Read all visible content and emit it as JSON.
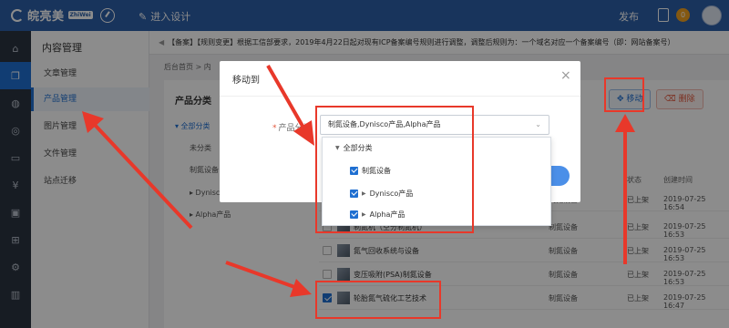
{
  "topbar": {
    "logo_text": "皖亮美",
    "logo_sub": "ZhiWei",
    "design_link": "进入设计",
    "publish": "发布",
    "badge_count": "0"
  },
  "rail_icons": [
    "home-icon",
    "copy-icon",
    "globe-icon",
    "compass-icon",
    "chat-icon",
    "dollar-icon",
    "bag-icon",
    "gift-icon",
    "settings-icon",
    "trash-icon"
  ],
  "sidebar": {
    "title": "内容管理",
    "items": [
      {
        "label": "文章管理"
      },
      {
        "label": "产品管理"
      },
      {
        "label": "图片管理"
      },
      {
        "label": "文件管理"
      },
      {
        "label": "站点迁移"
      }
    ]
  },
  "notice": {
    "text": "【备案】【规则变更】根据工信部要求，2019年4月22日起对现有ICP备案编号规则进行调整，调整后规则为：一个域名对应一个备案编号（即：网站备案号）"
  },
  "breadcrumb": {
    "home": "后台首页",
    "sep": ">",
    "current": "内"
  },
  "main": {
    "category_title": "产品分类",
    "categories": [
      {
        "label": "▾ 全部分类"
      },
      {
        "label": "未分类"
      },
      {
        "label": "制氮设备"
      },
      {
        "label": "▸ Dynisco产品"
      },
      {
        "label": "▸ Alpha产品"
      }
    ],
    "buttons": {
      "move": "移动",
      "delete": "删除",
      "move_icon": "move-icon",
      "delete_icon": "trash-icon"
    },
    "table_headers": {
      "status": "状态",
      "created": "创建时间"
    },
    "rows": [
      {
        "name": "",
        "category": "制氮设备",
        "status": "已上架",
        "time": "2019-07-25 16:54",
        "checked": false
      },
      {
        "name": "制氮机（空分制氮机）",
        "category": "制氮设备",
        "status": "已上架",
        "time": "2019-07-25 16:53",
        "checked": false
      },
      {
        "name": "氮气回收系统与设备",
        "category": "制氮设备",
        "status": "已上架",
        "time": "2019-07-25 16:53",
        "checked": false
      },
      {
        "name": "变压吸附(PSA)制氮设备",
        "category": "制氮设备",
        "status": "已上架",
        "time": "2019-07-25 16:53",
        "checked": false
      },
      {
        "name": "轮胎氮气硫化工艺技术",
        "category": "制氮设备",
        "status": "已上架",
        "time": "2019-07-25 16:47",
        "checked": true
      }
    ]
  },
  "modal": {
    "title": "移动到",
    "close": "×",
    "field_label": "产品分类",
    "required_mark": "*",
    "selected_value": "制氮设备,Dynisco产品,Alpha产品",
    "dropdown": {
      "root": "全部分类",
      "options": [
        {
          "label": "制氮设备",
          "checked": true
        },
        {
          "label": "Dynisco产品",
          "checked": true
        },
        {
          "label": "Alpha产品",
          "checked": true
        }
      ]
    }
  }
}
